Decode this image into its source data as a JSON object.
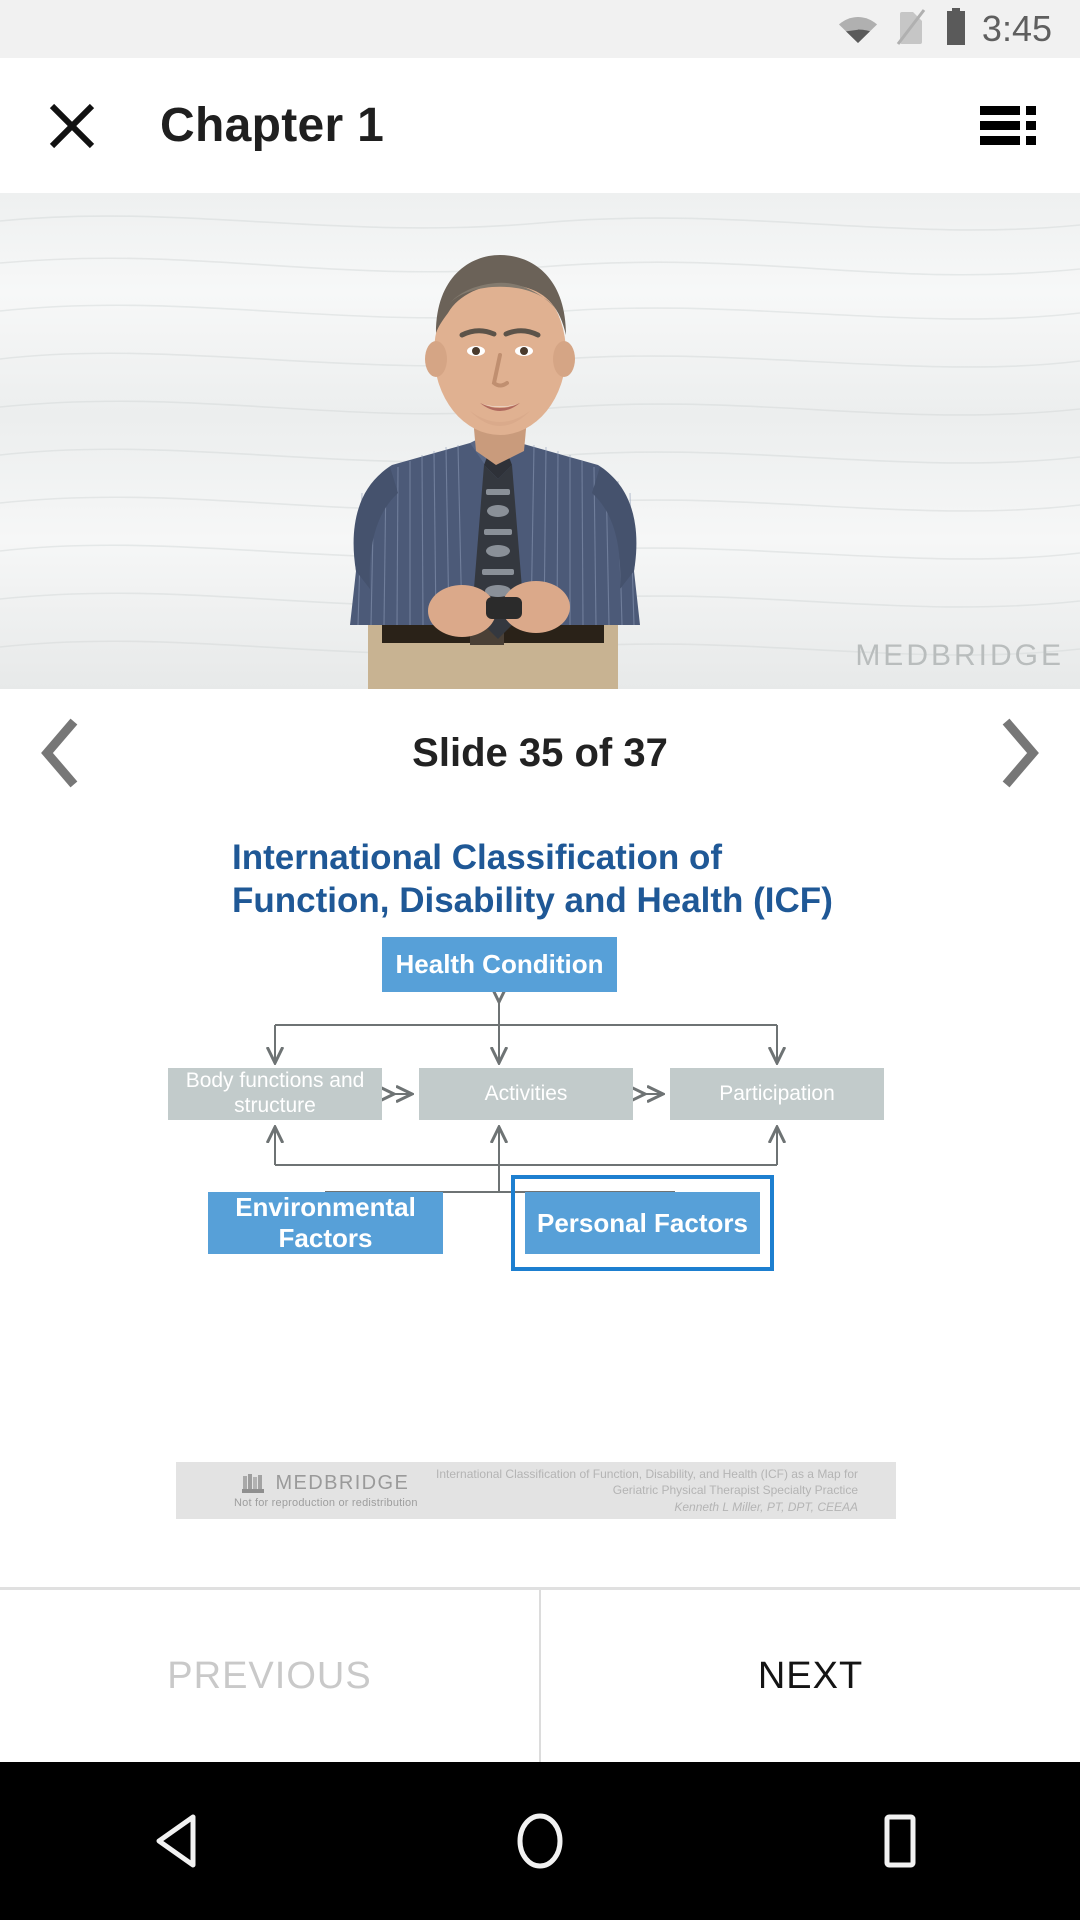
{
  "status_bar": {
    "time": "3:45",
    "icons": [
      "wifi-icon",
      "no-sim-icon",
      "battery-icon"
    ]
  },
  "app_bar": {
    "close_label": "close-icon",
    "title": "Chapter 1",
    "menu_label": "playlist-icon"
  },
  "video": {
    "watermark": "MEDBRIDGE"
  },
  "slide_nav": {
    "counter": "Slide 35 of 37",
    "prev_icon": "chevron-left-icon",
    "next_icon": "chevron-right-icon"
  },
  "slide": {
    "title": "International Classification of Function, Disability and Health (ICF)",
    "boxes": {
      "health": "Health Condition",
      "body": "Body functions and structure",
      "activities": "Activities",
      "participation": "Participation",
      "environmental": "Environmental Factors",
      "personal": "Personal Factors"
    },
    "footer": {
      "brand": "MEDBRIDGE",
      "brand_sub": "Not for reproduction or redistribution",
      "credit_line1": "International Classification of Function, Disability, and Health (ICF) as a Map for",
      "credit_line2": "Geriatric Physical Therapist Specialty Practice",
      "credit_line3": "Kenneth L Miller, PT, DPT, CEEAA"
    },
    "colors": {
      "title_blue": "#1f5896",
      "box_blue": "#57a0d8",
      "box_gray": "#c2cbcb",
      "selection_blue": "#1d7fd0",
      "footer_strip": "#e3e3e3"
    }
  },
  "bottom_nav": {
    "previous_label": "PREVIOUS",
    "next_label": "NEXT",
    "previous_enabled": false,
    "next_enabled": true
  },
  "system_nav": {
    "back": "back-triangle-icon",
    "home": "home-circle-icon",
    "recents": "recents-square-icon"
  }
}
